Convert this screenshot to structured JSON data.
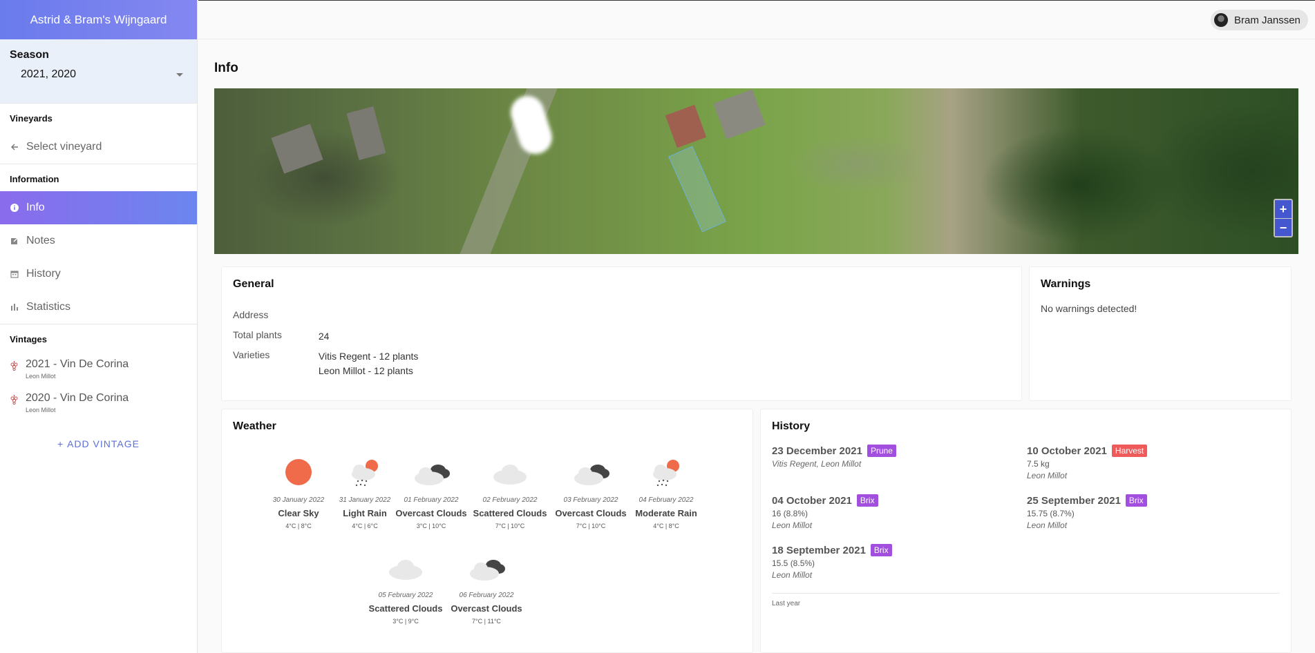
{
  "sidebar": {
    "brand": "Astrid & Bram's Wijngaard",
    "season_title": "Season",
    "season_value": "2021, 2020",
    "sections": {
      "vineyards": "Vineyards",
      "information": "Information",
      "vintages": "Vintages"
    },
    "select_vineyard": "Select vineyard",
    "nav": [
      {
        "label": "Info",
        "icon": "info-icon"
      },
      {
        "label": "Notes",
        "icon": "notes-icon"
      },
      {
        "label": "History",
        "icon": "calendar-icon"
      },
      {
        "label": "Statistics",
        "icon": "bar-chart-icon"
      }
    ],
    "vintages": [
      {
        "title": "2021 - Vin De Corina",
        "sub": "Leon Millot"
      },
      {
        "title": "2020 - Vin De Corina",
        "sub": "Leon Millot"
      }
    ],
    "add_vintage": "ADD VINTAGE"
  },
  "topbar": {
    "user": "Bram Janssen"
  },
  "main": {
    "title": "Info",
    "map_zoom_in": "+",
    "map_zoom_out": "−"
  },
  "general": {
    "title": "General",
    "address_label": "Address",
    "address_value": "",
    "plants_label": "Total plants",
    "plants_value": "24",
    "varieties_label": "Varieties",
    "varieties": [
      "Vitis Regent - 12 plants",
      "Leon Millot - 12 plants"
    ]
  },
  "warnings": {
    "title": "Warnings",
    "text": "No warnings detected!"
  },
  "weather": {
    "title": "Weather",
    "days": [
      {
        "date": "30 January 2022",
        "desc": "Clear Sky",
        "temp": "4°C | 8°C",
        "icon": "sun-icon"
      },
      {
        "date": "31 January 2022",
        "desc": "Light Rain",
        "temp": "4°C | 6°C",
        "icon": "rain-icon"
      },
      {
        "date": "01 February 2022",
        "desc": "Overcast Clouds",
        "temp": "3°C | 10°C",
        "icon": "overcast-icon"
      },
      {
        "date": "02 February 2022",
        "desc": "Scattered Clouds",
        "temp": "7°C | 10°C",
        "icon": "cloud-icon"
      },
      {
        "date": "03 February 2022",
        "desc": "Overcast Clouds",
        "temp": "7°C | 10°C",
        "icon": "overcast-icon"
      },
      {
        "date": "04 February 2022",
        "desc": "Moderate Rain",
        "temp": "4°C | 8°C",
        "icon": "rain-icon"
      },
      {
        "date": "05 February 2022",
        "desc": "Scattered Clouds",
        "temp": "3°C | 9°C",
        "icon": "cloud-icon"
      },
      {
        "date": "06 February 2022",
        "desc": "Overcast Clouds",
        "temp": "7°C | 11°C",
        "icon": "overcast-icon"
      }
    ]
  },
  "history": {
    "title": "History",
    "entries": [
      {
        "date": "23 December 2021",
        "tag": "Prune",
        "line1": "Vitis Regent, Leon Millot",
        "line2": ""
      },
      {
        "date": "10 October 2021",
        "tag": "Harvest",
        "line1": "7.5 kg",
        "line2": "Leon Millot"
      },
      {
        "date": "04 October 2021",
        "tag": "Brix",
        "line1": "16 (8.8%)",
        "line2": "Leon Millot"
      },
      {
        "date": "25 September 2021",
        "tag": "Brix",
        "line1": "15.75 (8.7%)",
        "line2": "Leon Millot"
      },
      {
        "date": "18 September 2021",
        "tag": "Brix",
        "line1": "15.5 (8.5%)",
        "line2": "Leon Millot"
      }
    ],
    "last_year": "Last year"
  }
}
